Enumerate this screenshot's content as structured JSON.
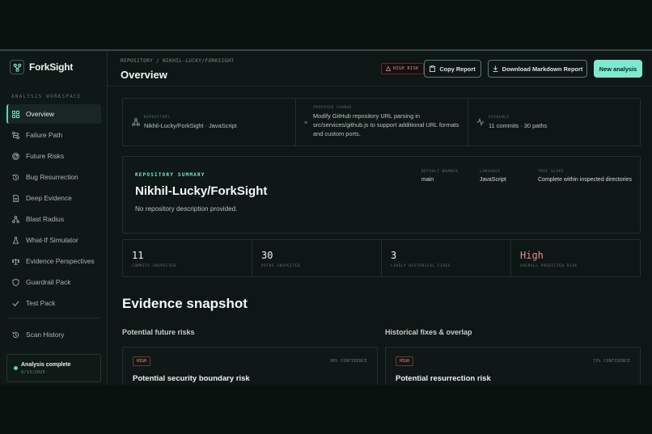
{
  "app": {
    "name": "ForkSight"
  },
  "sidebar": {
    "section_label": "ANALYSIS WORKSPACE",
    "items": [
      {
        "label": "Overview",
        "icon": "grid-icon"
      },
      {
        "label": "Failure Path",
        "icon": "route-icon"
      },
      {
        "label": "Future Risks",
        "icon": "radar-icon"
      },
      {
        "label": "Bug Resurrection",
        "icon": "history-icon"
      },
      {
        "label": "Deep Evidence",
        "icon": "file-icon"
      },
      {
        "label": "Blast Radius",
        "icon": "network-icon"
      },
      {
        "label": "What-If Simulator",
        "icon": "flask-icon"
      },
      {
        "label": "Evidence Perspectives",
        "icon": "scale-icon"
      },
      {
        "label": "Guardrail Pack",
        "icon": "shield-icon"
      },
      {
        "label": "Test Pack",
        "icon": "check-icon"
      }
    ],
    "scan_history": "Scan History",
    "status": {
      "title": "Analysis complete",
      "date": "6/13/2026"
    }
  },
  "header": {
    "breadcrumb": "REPOSITORY / NIKHIL-LUCKY/FORKSIGHT",
    "title": "Overview",
    "risk_badge": "HIGH RISK",
    "copy_label": "Copy Report",
    "download_label": "Download Markdown Report",
    "new_label": "New analysis"
  },
  "info": {
    "repository_label": "REPOSITORY",
    "repository_value": "Nikhil-Lucky/ForkSight · JavaScript",
    "change_label": "PROPOSED CHANGE",
    "change_value": "Modify GitHub repository URL parsing in src/services/github.js to support additional URL formats and custom ports.",
    "evidence_label": "EVIDENCE",
    "evidence_value": "11 commits · 30 paths"
  },
  "summary": {
    "kicker": "REPOSITORY SUMMARY",
    "title": "Nikhil-Lucky/ForkSight",
    "description": "No repository description provided.",
    "branch_label": "DEFAULT BRANCH",
    "branch_value": "main",
    "language_label": "LANGUAGE",
    "language_value": "JavaScript",
    "scope_label": "TREE SCOPE",
    "scope_value": "Complete within inspected directories"
  },
  "stats": [
    {
      "value": "11",
      "label": "COMMITS INSPECTED"
    },
    {
      "value": "30",
      "label": "PATHS INSPECTED"
    },
    {
      "value": "3",
      "label": "LIKELY HISTORICAL FIXES"
    },
    {
      "value": "High",
      "label": "OVERALL PREDICTED RISK"
    }
  ],
  "evidence": {
    "title": "Evidence snapshot",
    "left_title": "Potential future risks",
    "right_title": "Historical fixes & overlap",
    "left_card": {
      "badge": "HIGH",
      "confidence": "90% CONFIDENCE",
      "title": "Potential security boundary risk"
    },
    "right_card": {
      "badge": "HIGH",
      "confidence": "72% CONFIDENCE",
      "title": "Potential resurrection risk"
    }
  },
  "colors": {
    "accent": "#7ee8d0",
    "danger": "#ef8a8a",
    "background": "#0d1715"
  }
}
